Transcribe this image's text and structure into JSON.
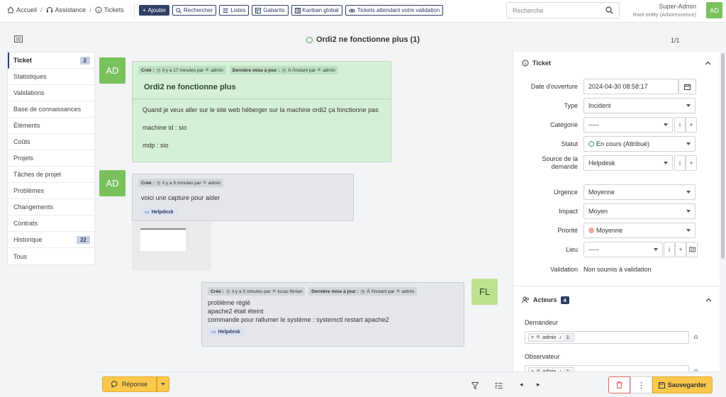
{
  "breadcrumb": {
    "home": "Accueil",
    "assistance": "Assistance",
    "tickets": "Tickets"
  },
  "toolbar": {
    "add": "Ajouter",
    "search": "Rechercher",
    "lists": "Listes",
    "templates": "Gabarits",
    "kanban": "Kanban global",
    "pending": "Tickets attendant votre validation"
  },
  "search": {
    "placeholder": "Recherche"
  },
  "user": {
    "name": "Super-Admin",
    "entity": "Root entity (Arborescence)",
    "initials": "AD"
  },
  "ticket": {
    "title": "Ordi2 ne fonctionne plus (1)",
    "pager": "1/1"
  },
  "tabs": [
    {
      "label": "Ticket",
      "badge": "2"
    },
    {
      "label": "Statistiques"
    },
    {
      "label": "Validations"
    },
    {
      "label": "Base de connaissances"
    },
    {
      "label": "Éléments"
    },
    {
      "label": "Coûts"
    },
    {
      "label": "Projets"
    },
    {
      "label": "Tâches de projet"
    },
    {
      "label": "Problèmes"
    },
    {
      "label": "Changements"
    },
    {
      "label": "Contrats"
    },
    {
      "label": "Historique",
      "badge": "22"
    },
    {
      "label": "Tous"
    }
  ],
  "timeline": {
    "item1": {
      "avatar": "AD",
      "created_label": "Créé :",
      "created_time": "il y a 17 minutes par",
      "created_user": "admin",
      "updated_label": "Dernière mise à jour :",
      "updated_time": "À l'instant par",
      "updated_user": "admin",
      "title": "Ordi2 ne fonctionne plus",
      "line1": "Quand je veux aller sur le site web héberger sur la machine ordi2 ça fonctionne pas",
      "line2": "machine id : sio",
      "line3": "mdp : sio"
    },
    "item2": {
      "avatar": "AD",
      "created_label": "Créé :",
      "created_time": "il y a 9 minutes par",
      "created_user": "admin",
      "text": "voici une capture pour aider",
      "source": "Helpdesk"
    },
    "item3": {
      "avatar": "FL",
      "created_label": "Créé :",
      "created_time": "il y a 3 minutes par",
      "created_user": "lucas florian",
      "updated_label": "Dernière mise à jour :",
      "updated_time": "À l'instant par",
      "updated_user": "admin",
      "line1": "problème réglé",
      "line2": "apache2 était éteint",
      "line3": "commande pour rallumer le système : systemctl restart apache2",
      "source": "Helpdesk"
    }
  },
  "footer": {
    "reply": "Réponse",
    "save": "Sauvegarder"
  },
  "side": {
    "section": "Ticket",
    "fields": {
      "open_date_label": "Date d'ouverture",
      "open_date": "2024-04-30 08:58:17",
      "type_label": "Type",
      "type": "Incident",
      "category_label": "Catégorie",
      "category": "-----",
      "status_label": "Statut",
      "status": "En cours (Attribué)",
      "source_label1": "Source de la",
      "source_label2": "demande",
      "source": "Helpdesk",
      "urgency_label": "Urgence",
      "urgency": "Moyenne",
      "impact_label": "Impact",
      "impact": "Moyen",
      "priority_label": "Priorité",
      "priority": "Moyenne",
      "location_label": "Lieu",
      "location": "-----",
      "validation_label": "Validation",
      "validation": "Non soumis à validation"
    },
    "actors": {
      "title": "Acteurs",
      "count": "4",
      "requester_label": "Demandeur",
      "requester": "admin",
      "requester_n": "1",
      "observer_label": "Observateur",
      "observer": "admin",
      "observer_n": "1"
    }
  },
  "colors": {
    "brand": "#2f3f64",
    "accent": "#fbc84c",
    "avatar": "#7ac15d",
    "followup": "#d5f0d6"
  }
}
